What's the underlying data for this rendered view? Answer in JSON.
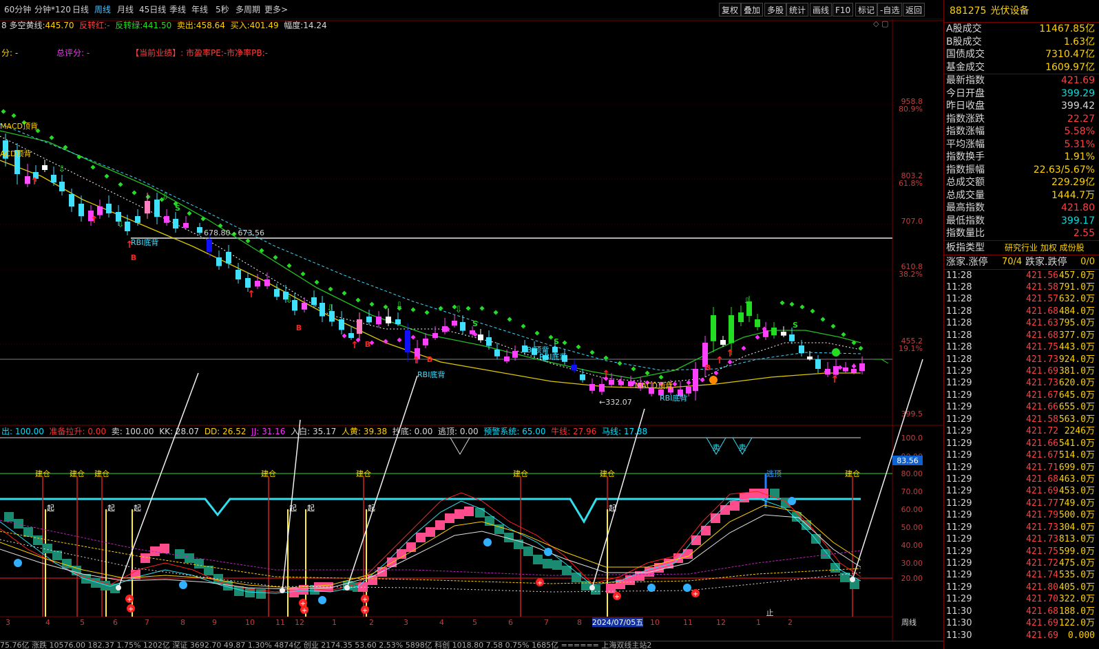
{
  "periods": [
    "60分钟",
    "分钟*120",
    "日线",
    "周线",
    "月线",
    "45日线",
    "季线",
    "年线",
    "5秒",
    "多周期",
    "更多>"
  ],
  "active_period": "周线",
  "tools": [
    "复权",
    "叠加",
    "多股",
    "统计",
    "画线",
    "F10",
    "标记",
    "-自选",
    "返回"
  ],
  "legend": {
    "prefix": "8",
    "duokong_label": "多空黄线:",
    "duokong_val": "445.70",
    "fzh_label": "反转红:",
    "fzh_val": "-",
    "fzl_label": "反转绿:",
    "fzl_val": "441.50",
    "sell_label": "卖出:",
    "sell_val": "458.64",
    "buy_label": "买入:",
    "buy_val": "401.49",
    "amp_label": "幅度:",
    "amp_val": "14.24"
  },
  "legend2": {
    "score_label": "分:",
    "score_val": "-",
    "total_label": "总评分:",
    "total_val": "-",
    "perf": "【当前业绩】: 市盈率PE:-市净率PB:-"
  },
  "main_price_labels": [
    {
      "price": "958.8",
      "pct": "80.9%"
    },
    {
      "price": "803.2",
      "pct": "61.8%"
    },
    {
      "price": "707.0",
      "pct": ""
    },
    {
      "price": "610.8",
      "pct": "38.2%"
    },
    {
      "price": "455.2",
      "pct": "19.1%"
    },
    {
      "price": "399.5",
      "pct": ""
    }
  ],
  "annotations": {
    "macd1": "MACD顶背",
    "macd2": "ACD顶背",
    "rbi1": "RBI底背",
    "range": "678.80 - 673.56",
    "rbi2": "RBI顶背",
    "rbi3": "RBI底背",
    "rbi4": "RBI底背",
    "macd3": "MACD顶背",
    "rbi5": "RBI底背",
    "low": "←332.07"
  },
  "sub_legend": {
    "out": "出: 100.00",
    "zbd": "准备拉升: 0.00",
    "sell": "卖: 100.00",
    "kk": "KK: 28.07",
    "dd": "DD: 26.52",
    "jj": "JJ: 31.16",
    "rb": "入白: 35.17",
    "rh": "人黄: 39.38",
    "cd": "抄底: 0.00",
    "tp": "逃顶: 0.00",
    "yj": "预警系统: 65.00",
    "nx": "牛线: 27.96",
    "mx": "马线: 17.88"
  },
  "sub_axis": [
    "100.0",
    "90.00",
    "80.00",
    "70.00",
    "60.00",
    "50.00",
    "40.00",
    "30.00",
    "20.00"
  ],
  "sub_tag": "83.56",
  "jiancang": "建仓",
  "qi": "起",
  "taodun": "逃顶",
  "mai": "卖",
  "zhi": "止",
  "date_axis": [
    "3",
    "4",
    "5",
    "6",
    "7",
    "8",
    "9",
    "10",
    "11",
    "12",
    "1",
    "2",
    "3",
    "4",
    "5",
    "6",
    "7",
    "8",
    "9",
    "10",
    "11",
    "12",
    "1",
    "2"
  ],
  "date_highlight": "2024/07/05五",
  "period_tag": "周线",
  "status": "75.76亿 涨跌 10576.00 182.37 1.75%  1202亿 深证 3692.70 49.87 1.30%  4874亿 创业 2174.35 53.60 2.53%  5898亿 科创 1018.80 7.58 0.75%  1685亿 ======  上海双线主站2",
  "panel": {
    "code": "881275",
    "name": "光伏设备",
    "rows1": [
      {
        "label": "A股成交",
        "value": "11467.85亿",
        "color": "#ffd200"
      },
      {
        "label": "B股成交",
        "value": "1.63亿",
        "color": "#ffd200"
      },
      {
        "label": "国债成交",
        "value": "7310.47亿",
        "color": "#ffd200"
      },
      {
        "label": "基金成交",
        "value": "1609.97亿",
        "color": "#ffd200"
      }
    ],
    "rows2": [
      {
        "label": "最新指数",
        "value": "421.69",
        "color": "#ff4040"
      },
      {
        "label": "今日开盘",
        "value": "399.29",
        "color": "#00e0e0"
      },
      {
        "label": "昨日收盘",
        "value": "399.42",
        "color": "#d8d8d8"
      },
      {
        "label": "指数涨跌",
        "value": "22.27",
        "color": "#ff4040"
      },
      {
        "label": "指数涨幅",
        "value": "5.58%",
        "color": "#ff4040"
      },
      {
        "label": "平均涨幅",
        "value": "5.31%",
        "color": "#ff4040"
      },
      {
        "label": "指数换手",
        "value": "1.91%",
        "color": "#ffd200"
      },
      {
        "label": "指数振幅",
        "value": "22.63/5.67%",
        "color": "#ffd200"
      },
      {
        "label": "总成交额",
        "value": "229.29亿",
        "color": "#ffd200"
      },
      {
        "label": "总成交量",
        "value": "1444.7万",
        "color": "#ffd200"
      },
      {
        "label": "最高指数",
        "value": "421.80",
        "color": "#ff4040"
      },
      {
        "label": "最低指数",
        "value": "399.17",
        "color": "#00e0e0"
      },
      {
        "label": "指数量比",
        "value": "2.55",
        "color": "#ff4040"
      }
    ],
    "board_type_label": "板指类型",
    "board_type_value": "研究行业 加权 成份股",
    "updown_label": "涨家.涨停",
    "updown_value": "70/4",
    "fall_label": "跌家.跌停",
    "fall_value": "0/0",
    "ticks": [
      {
        "t": "11:28",
        "p": "421.56",
        "v": "457.0万"
      },
      {
        "t": "11:28",
        "p": "421.58",
        "v": "791.0万"
      },
      {
        "t": "11:28",
        "p": "421.57",
        "v": "632.0万"
      },
      {
        "t": "11:28",
        "p": "421.68",
        "v": "484.0万"
      },
      {
        "t": "11:28",
        "p": "421.63",
        "v": "795.0万"
      },
      {
        "t": "11:28",
        "p": "421.68",
        "v": "377.0万"
      },
      {
        "t": "11:28",
        "p": "421.75",
        "v": "443.0万"
      },
      {
        "t": "11:28",
        "p": "421.73",
        "v": "924.0万"
      },
      {
        "t": "11:29",
        "p": "421.69",
        "v": "381.0万"
      },
      {
        "t": "11:29",
        "p": "421.73",
        "v": "620.0万"
      },
      {
        "t": "11:29",
        "p": "421.67",
        "v": "645.0万"
      },
      {
        "t": "11:29",
        "p": "421.66",
        "v": "655.0万"
      },
      {
        "t": "11:29",
        "p": "421.58",
        "v": "563.0万"
      },
      {
        "t": "11:29",
        "p": "421.72",
        "v": "2246万"
      },
      {
        "t": "11:29",
        "p": "421.66",
        "v": "541.0万"
      },
      {
        "t": "11:29",
        "p": "421.67",
        "v": "514.0万"
      },
      {
        "t": "11:29",
        "p": "421.71",
        "v": "699.0万"
      },
      {
        "t": "11:29",
        "p": "421.68",
        "v": "463.0万"
      },
      {
        "t": "11:29",
        "p": "421.69",
        "v": "453.0万"
      },
      {
        "t": "11:29",
        "p": "421.77",
        "v": "749.0万"
      },
      {
        "t": "11:29",
        "p": "421.79",
        "v": "500.0万"
      },
      {
        "t": "11:29",
        "p": "421.73",
        "v": "304.0万"
      },
      {
        "t": "11:29",
        "p": "421.73",
        "v": "813.0万"
      },
      {
        "t": "11:29",
        "p": "421.75",
        "v": "599.0万"
      },
      {
        "t": "11:29",
        "p": "421.72",
        "v": "475.0万"
      },
      {
        "t": "11:29",
        "p": "421.74",
        "v": "535.0万"
      },
      {
        "t": "11:29",
        "p": "421.80",
        "v": "405.0万"
      },
      {
        "t": "11:29",
        "p": "421.70",
        "v": "322.0万"
      },
      {
        "t": "11:30",
        "p": "421.68",
        "v": "188.0万"
      },
      {
        "t": "11:30",
        "p": "421.69",
        "v": "122.0万"
      },
      {
        "t": "11:30",
        "p": "421.69",
        "v": "0.000"
      }
    ]
  }
}
